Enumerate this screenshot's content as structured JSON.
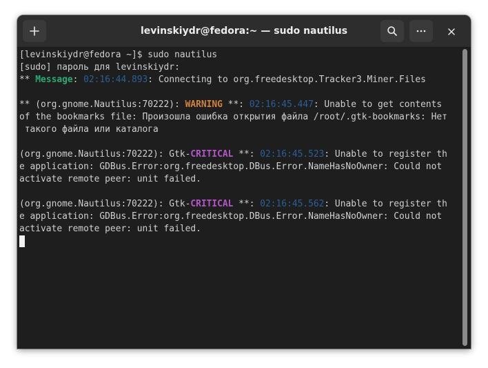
{
  "window": {
    "title": "levinskiydr@fedora:~ — sudo nautilus"
  },
  "titlebar": {
    "new_tab_icon": "plus-icon",
    "search_icon": "search-icon",
    "menu_icon": "ellipsis-icon",
    "close_icon": "close-icon"
  },
  "terminal": {
    "lines": [
      {
        "segments": [
          {
            "text": "[levinskiydr@fedora ~]$ sudo nautilus",
            "style": ""
          }
        ]
      },
      {
        "segments": [
          {
            "text": "[sudo] пароль для levinskiydr:",
            "style": ""
          }
        ]
      },
      {
        "segments": [
          {
            "text": "** ",
            "style": ""
          },
          {
            "text": "Message",
            "style": "green"
          },
          {
            "text": ": ",
            "style": ""
          },
          {
            "text": "02:16:44.893",
            "style": "ts"
          },
          {
            "text": ": Connecting to org.freedesktop.Tracker3.Miner.Files",
            "style": ""
          }
        ]
      },
      {
        "segments": [
          {
            "text": "",
            "style": ""
          }
        ]
      },
      {
        "segments": [
          {
            "text": "** (org.gnome.Nautilus:70222): ",
            "style": ""
          },
          {
            "text": "WARNING",
            "style": "orange"
          },
          {
            "text": " **: ",
            "style": ""
          },
          {
            "text": "02:16:45.447",
            "style": "ts"
          },
          {
            "text": ": Unable to get contents",
            "style": ""
          }
        ]
      },
      {
        "segments": [
          {
            "text": "of the bookmarks file: Произошла ошибка открытия файла /root/.gtk-bookmarks: Нет",
            "style": ""
          }
        ]
      },
      {
        "segments": [
          {
            "text": " такого файла или каталога",
            "style": ""
          }
        ]
      },
      {
        "segments": [
          {
            "text": "",
            "style": ""
          }
        ]
      },
      {
        "segments": [
          {
            "text": "(org.gnome.Nautilus:70222): Gtk-",
            "style": ""
          },
          {
            "text": "CRITICAL",
            "style": "purple"
          },
          {
            "text": " **: ",
            "style": ""
          },
          {
            "text": "02:16:45.523",
            "style": "ts"
          },
          {
            "text": ": Unable to register th",
            "style": ""
          }
        ]
      },
      {
        "segments": [
          {
            "text": "e application: GDBus.Error:org.freedesktop.DBus.Error.NameHasNoOwner: Could not",
            "style": ""
          }
        ]
      },
      {
        "segments": [
          {
            "text": "activate remote peer: unit failed.",
            "style": ""
          }
        ]
      },
      {
        "segments": [
          {
            "text": "",
            "style": ""
          }
        ]
      },
      {
        "segments": [
          {
            "text": "(org.gnome.Nautilus:70222): Gtk-",
            "style": ""
          },
          {
            "text": "CRITICAL",
            "style": "purple"
          },
          {
            "text": " **: ",
            "style": ""
          },
          {
            "text": "02:16:45.562",
            "style": "ts"
          },
          {
            "text": ": Unable to register th",
            "style": ""
          }
        ]
      },
      {
        "segments": [
          {
            "text": "e application: GDBus.Error:org.freedesktop.DBus.Error.NameHasNoOwner: Could not",
            "style": ""
          }
        ]
      },
      {
        "segments": [
          {
            "text": "activate remote peer: unit failed.",
            "style": ""
          }
        ]
      }
    ]
  },
  "colors": {
    "message": "#2aa876",
    "warning": "#d2833e",
    "critical": "#b457c9",
    "timestamp": "#2a5f9a",
    "text": "#d0d0d0",
    "background": "#1e1e1e"
  }
}
